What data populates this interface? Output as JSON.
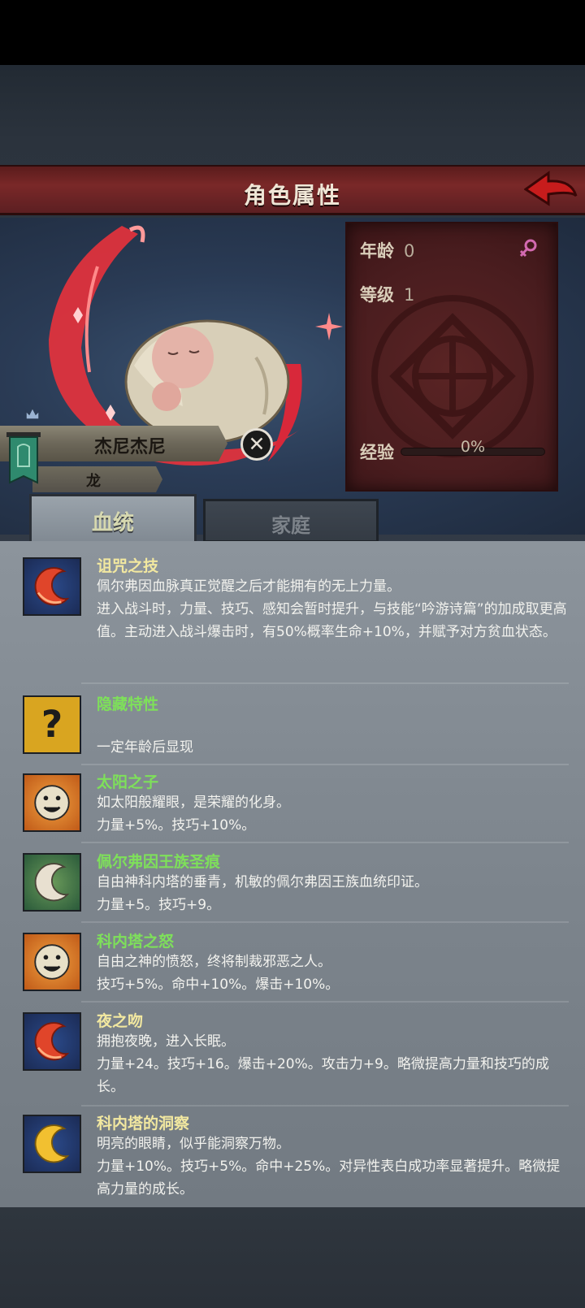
{
  "header": {
    "title": "角色属性"
  },
  "character": {
    "name": "杰尼杰尼",
    "race": "龙",
    "stats": [
      {
        "label": "年龄",
        "value": "0"
      },
      {
        "label": "等级",
        "value": "1"
      }
    ],
    "exp": {
      "label": "经验",
      "value": "0%",
      "fraction": 0
    }
  },
  "tabs": {
    "active": "血统",
    "inactive": "家庭"
  },
  "traits": [
    {
      "title": "诅咒之技",
      "title_color": "#f2e8a0",
      "desc": "佩尔弗因血脉真正觉醒之后才能拥有的无上力量。\n进入战斗时，力量、技巧、感知会暂时提升，与技能“吟游诗篇”的加成取更高值。主动进入战斗爆击时，有50%概率生命+10%，并赋予对方贫血状态。",
      "icon": "red-crescent-icon"
    },
    {
      "title": "隐藏特性",
      "title_color": "#7ee05a",
      "desc": "一定年龄后显现",
      "icon": "question-mark-icon"
    },
    {
      "title": "太阳之子",
      "title_color": "#7ee05a",
      "desc": "如太阳般耀眼，是荣耀的化身。\n力量+5%。技巧+10%。",
      "icon": "sun-face-icon"
    },
    {
      "title": "佩尔弗因王族圣痕",
      "title_color": "#7ee05a",
      "desc": "自由神科内塔的垂青，机敏的佩尔弗因王族血统印证。\n力量+5。技巧+9。",
      "icon": "white-crescent-icon"
    },
    {
      "title": "科内塔之怒",
      "title_color": "#7ee05a",
      "desc": "自由之神的愤怒，终将制裁邪恶之人。\n技巧+5%。命中+10%。爆击+10%。",
      "icon": "sun-face-icon"
    },
    {
      "title": "夜之吻",
      "title_color": "#f2e8a0",
      "desc": "拥抱夜晚，进入长眠。\n力量+24。技巧+16。爆击+20%。攻击力+9。略微提高力量和技巧的成长。",
      "icon": "red-crescent-icon"
    },
    {
      "title": "科内塔的洞察",
      "title_color": "#f2e8a0",
      "desc": "明亮的眼睛，似乎能洞察万物。\n力量+10%。技巧+5%。命中+25%。对异性表白成功率显著提升。略微提高力量的成长。",
      "icon": "gold-crescent-icon"
    }
  ]
}
